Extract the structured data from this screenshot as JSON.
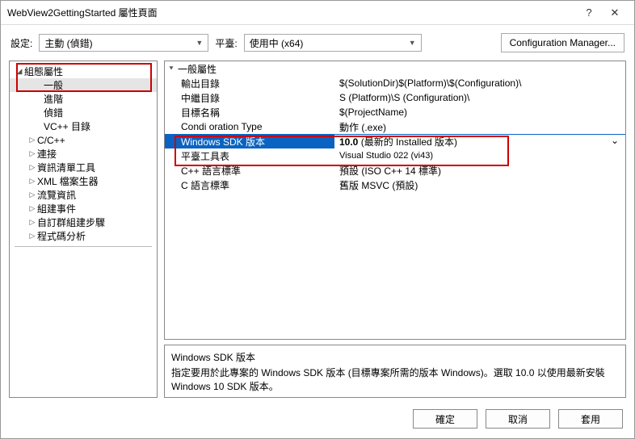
{
  "window": {
    "title": "WebView2GettingStarted 屬性頁面"
  },
  "toolbar": {
    "config_label": "設定:",
    "config_value": "主動 (偵錯)",
    "platform_label": "平臺:",
    "platform_value": "使用中 (x64)",
    "manager_button": "Configuration Manager..."
  },
  "tree": {
    "root": "組態屬性",
    "items": [
      {
        "label": "一般",
        "selected": true,
        "leaf": true
      },
      {
        "label": "進階",
        "leaf": true
      },
      {
        "label": "偵錯",
        "leaf": true
      },
      {
        "label": "VC++ 目錄",
        "leaf": true
      },
      {
        "label": "C/C++",
        "leaf": false
      },
      {
        "label": "連接",
        "leaf": false
      },
      {
        "label": "資訊清單工具",
        "leaf": false
      },
      {
        "label": "XML 檔案生器",
        "leaf": false
      },
      {
        "label": "流覽資訊",
        "leaf": false
      },
      {
        "label": "組建事件",
        "leaf": false
      },
      {
        "label": "自訂群組建步驟",
        "leaf": false
      },
      {
        "label": "程式碼分析",
        "leaf": false
      }
    ]
  },
  "grid": {
    "group": "一般屬性",
    "rows": [
      {
        "name": "輸出目錄",
        "value": "$(SolutionDir)$(Platform)\\$(Configuration)\\"
      },
      {
        "name": "中繼目錄",
        "value": "S (Platform)\\S (Configuration)\\"
      },
      {
        "name": "目標名稱",
        "value": "$(ProjectName)"
      },
      {
        "name": "Condi oration    Type",
        "value": "動作 (.exe)"
      },
      {
        "name": "Windows SDK 版本",
        "value": "10.0 (最新的 Installed 版本)",
        "selected": true,
        "dropdown": true
      },
      {
        "name": "平臺工具表",
        "value": "Visual Studio 022 (vi43)",
        "small": true
      },
      {
        "name": "C++ 語言標準",
        "value": "預設 (ISO C++ 14 標準)"
      },
      {
        "name": "C 語言標準",
        "value": "舊版 MSVC (預設)"
      }
    ]
  },
  "description": {
    "title": "Windows SDK 版本",
    "text": "指定要用於此專案的 Windows SDK 版本 (目標專案所需的版本 Windows)。選取 10.0 以使用最新安裝 Windows 10 SDK 版本。"
  },
  "footer": {
    "ok": "確定",
    "cancel": "取消",
    "apply": "套用"
  }
}
